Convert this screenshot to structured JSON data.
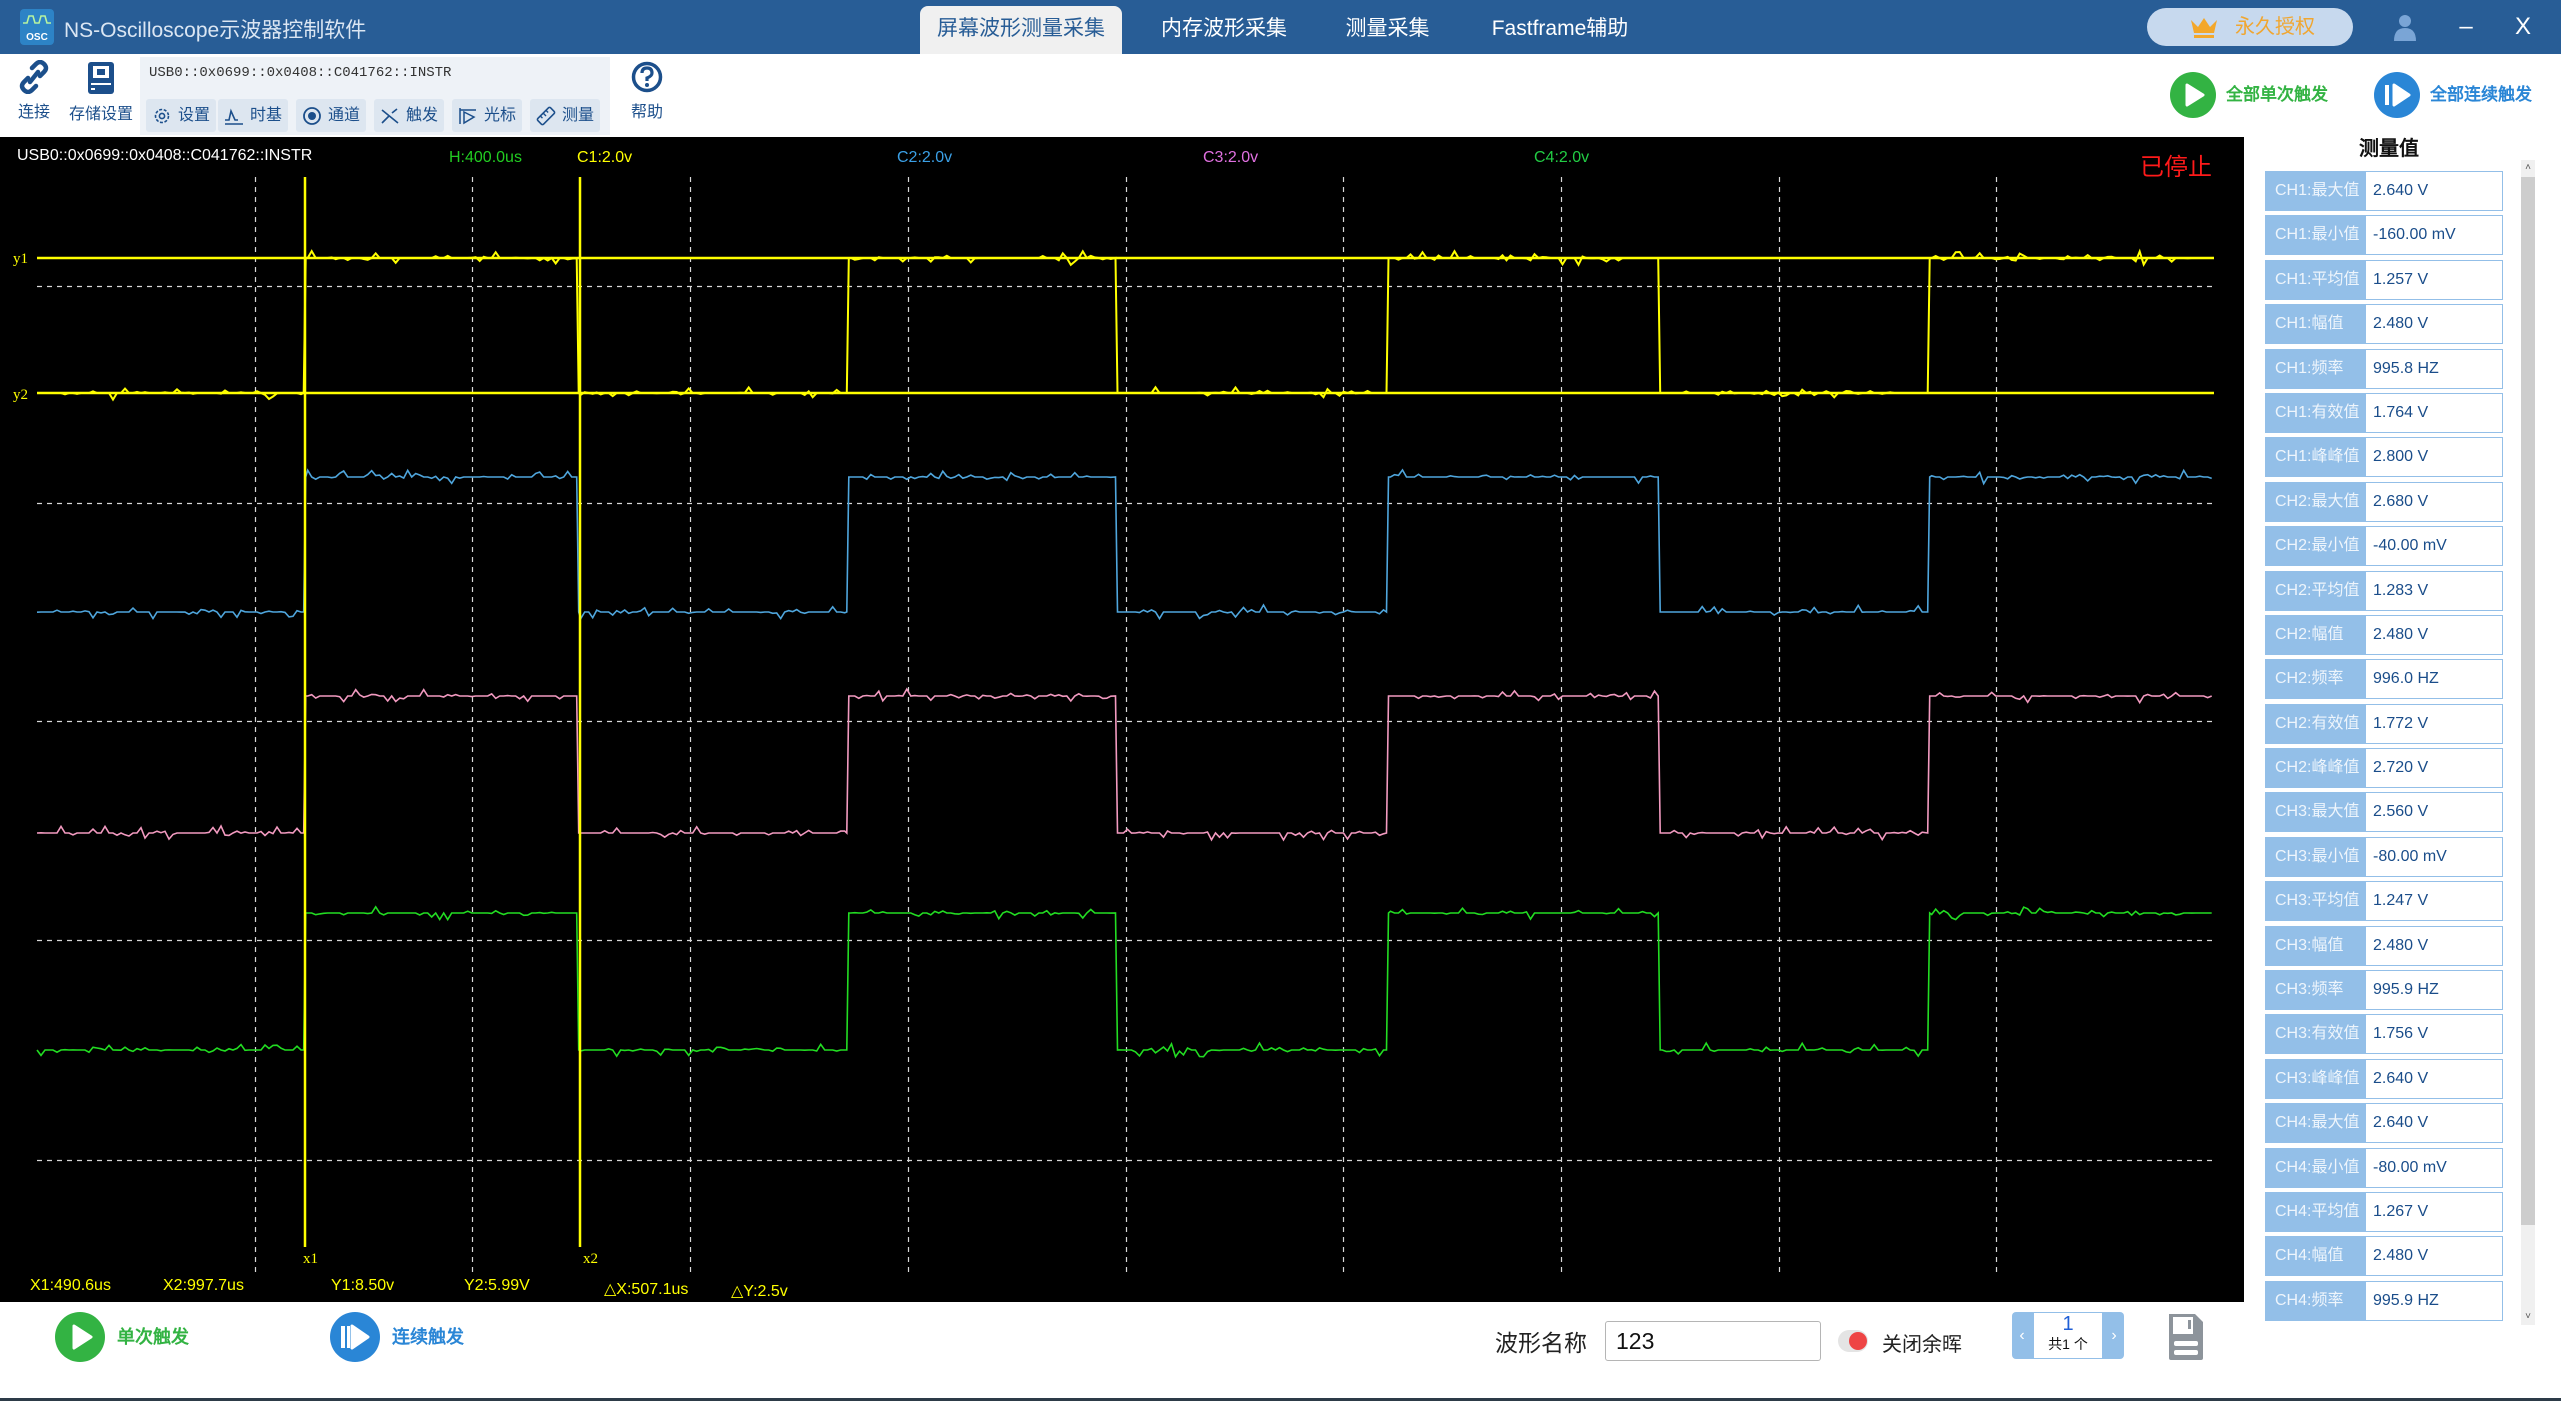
{
  "app": {
    "title": "NS-Oscilloscope示波器控制软件",
    "logo_text": "OSC"
  },
  "tabs": [
    {
      "label": "屏幕波形测量采集",
      "active": true
    },
    {
      "label": "内存波形采集",
      "active": false
    },
    {
      "label": "测量采集",
      "active": false
    },
    {
      "label": "Fastframe辅助",
      "active": false
    }
  ],
  "license": {
    "label": "永久授权"
  },
  "window_controls": {
    "minimize": "–",
    "close": "X"
  },
  "toolbar": {
    "connect_label": "连接",
    "storage_label": "存储设置",
    "instrument_address": "USB0::0x0699::0x0408::C041762::INSTR",
    "sub_buttons": [
      {
        "label": "设置",
        "icon": "gear-icon"
      },
      {
        "label": "时基",
        "icon": "timebase-icon"
      },
      {
        "label": "通道",
        "icon": "channel-icon"
      },
      {
        "label": "触发",
        "icon": "trigger-icon"
      },
      {
        "label": "光标",
        "icon": "cursor-icon"
      },
      {
        "label": "测量",
        "icon": "measure-icon"
      }
    ],
    "help_label": "帮助",
    "all_single_label": "全部单次触发",
    "all_continuous_label": "全部连续触发"
  },
  "scope": {
    "instrument_address": "USB0::0x0699::0x0408::C041762::INSTR",
    "timebase": "H:400.0us",
    "channels": [
      {
        "label": "C1:2.0v",
        "color": "#ffff00"
      },
      {
        "label": "C2:2.0v",
        "color": "#3ba0e6"
      },
      {
        "label": "C3:2.0v",
        "color": "#e070e0"
      },
      {
        "label": "C4:2.0v",
        "color": "#22cc44"
      }
    ],
    "status": "已停止",
    "cursor_labels": {
      "y1": "y1",
      "y2": "y2",
      "x1": "x1",
      "x2": "x2"
    },
    "readouts": {
      "x1": "X1:490.6us",
      "x2": "X2:997.7us",
      "y1": "Y1:8.50v",
      "y2": "Y2:5.99V",
      "dx": "△X:507.1us",
      "dy": "△Y:2.5v"
    },
    "grid": {
      "h_divisions": 10,
      "v_divisions": 8
    },
    "trace_colors": {
      "ch1": "#ffff00",
      "ch2": "#4fa6dd",
      "ch3": "#f29ac0",
      "ch4": "#22dd22"
    },
    "edges_fraction": [
      0.1225,
      0.2479,
      0.372,
      0.4954,
      0.6199,
      0.7447,
      0.8685
    ],
    "first_state": "low"
  },
  "bottom": {
    "single_label": "单次触发",
    "continuous_label": "连续触发",
    "wave_name_label": "波形名称",
    "wave_name_value": "123",
    "persistence_label": "关闭余晖",
    "page_current": "1",
    "page_total": "共1  个"
  },
  "measurements": {
    "title": "测量值",
    "items": [
      {
        "key": "CH1:最大值",
        "value": "2.640 V"
      },
      {
        "key": "CH1:最小值",
        "value": "-160.00 mV"
      },
      {
        "key": "CH1:平均值",
        "value": "1.257 V"
      },
      {
        "key": "CH1:幅值",
        "value": "2.480 V"
      },
      {
        "key": "CH1:频率",
        "value": "995.8 HZ"
      },
      {
        "key": "CH1:有效值",
        "value": "1.764 V"
      },
      {
        "key": "CH1:峰峰值",
        "value": "2.800 V"
      },
      {
        "key": "CH2:最大值",
        "value": "2.680 V"
      },
      {
        "key": "CH2:最小值",
        "value": "-40.00 mV"
      },
      {
        "key": "CH2:平均值",
        "value": "1.283 V"
      },
      {
        "key": "CH2:幅值",
        "value": "2.480 V"
      },
      {
        "key": "CH2:频率",
        "value": "996.0 HZ"
      },
      {
        "key": "CH2:有效值",
        "value": "1.772 V"
      },
      {
        "key": "CH2:峰峰值",
        "value": "2.720 V"
      },
      {
        "key": "CH3:最大值",
        "value": "2.560 V"
      },
      {
        "key": "CH3:最小值",
        "value": "-80.00 mV"
      },
      {
        "key": "CH3:平均值",
        "value": "1.247 V"
      },
      {
        "key": "CH3:幅值",
        "value": "2.480 V"
      },
      {
        "key": "CH3:频率",
        "value": "995.9 HZ"
      },
      {
        "key": "CH3:有效值",
        "value": "1.756 V"
      },
      {
        "key": "CH3:峰峰值",
        "value": "2.640 V"
      },
      {
        "key": "CH4:最大值",
        "value": "2.640 V"
      },
      {
        "key": "CH4:最小值",
        "value": "-80.00 mV"
      },
      {
        "key": "CH4:平均值",
        "value": "1.267 V"
      },
      {
        "key": "CH4:幅值",
        "value": "2.480 V"
      },
      {
        "key": "CH4:频率",
        "value": "995.9 HZ"
      }
    ]
  }
}
